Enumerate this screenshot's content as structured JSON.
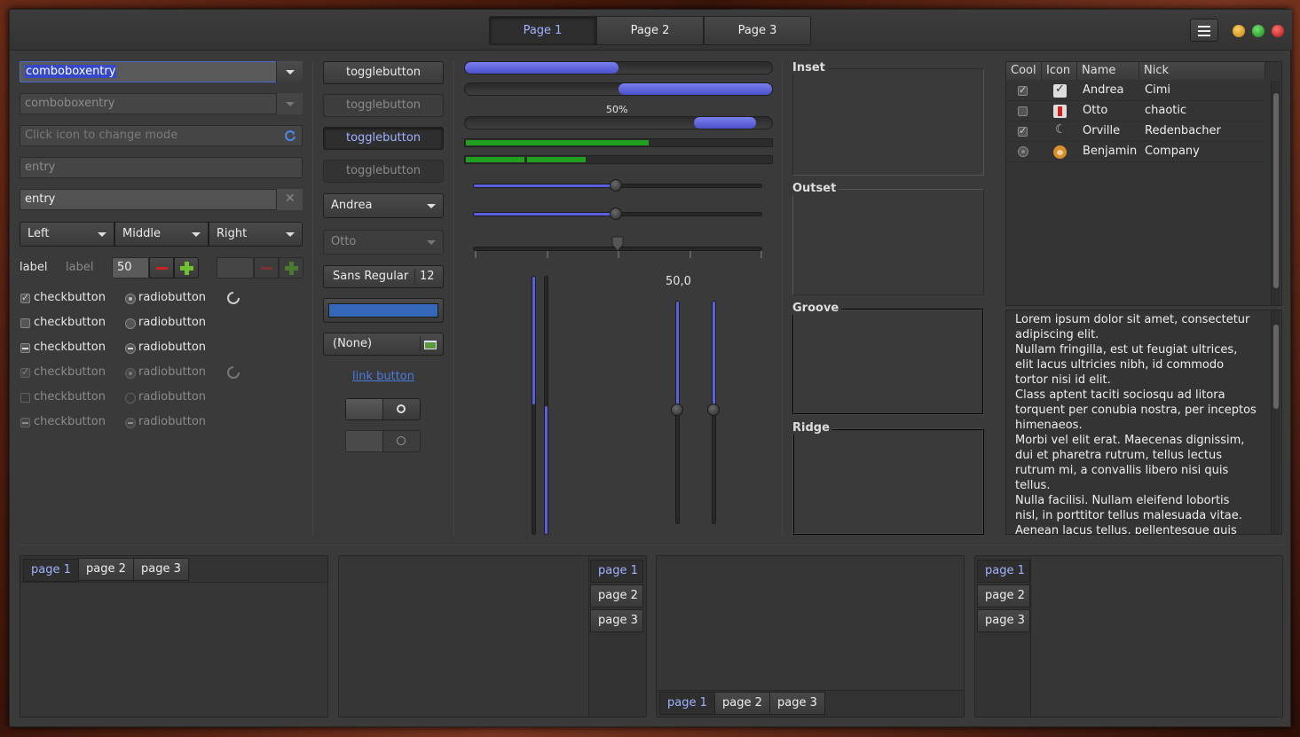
{
  "header": {
    "tabs": [
      "Page 1",
      "Page 2",
      "Page 3"
    ],
    "menu_icon": "hamburger-icon",
    "window_buttons": [
      "minimize-icon",
      "maximize-icon",
      "close-icon"
    ],
    "window_button_colors": [
      "#e0a020",
      "#30b030",
      "#e03030"
    ]
  },
  "col1": {
    "combo1": "comboboxentry",
    "combo2": "comboboxentry",
    "entry_icon_placeholder": "Click icon to change mode",
    "entry_dis": "entry",
    "entry": "entry",
    "combo_left": "Left",
    "combo_middle": "Middle",
    "combo_right": "Right",
    "label1": "label",
    "label2": "label",
    "spin_value": "50",
    "checks": [
      "checkbutton",
      "checkbutton",
      "checkbutton",
      "checkbutton",
      "checkbutton",
      "checkbutton"
    ],
    "radios": [
      "radiobutton",
      "radiobutton",
      "radiobutton",
      "radiobutton",
      "radiobutton",
      "radiobutton"
    ]
  },
  "col2": {
    "toggles": [
      "togglebutton",
      "togglebutton",
      "togglebutton",
      "togglebutton"
    ],
    "combo_andrea": "Andrea",
    "combo_otto": "Otto",
    "font_name": "Sans Regular",
    "font_size": "12",
    "color_value": "#3568b8",
    "file_chooser": "(None)",
    "link": "link button"
  },
  "col3": {
    "progress": [
      0.5,
      0.5,
      0.5
    ],
    "progress_label": "50%",
    "level": [
      0.6,
      0.4
    ],
    "scale_value_label": "50,0",
    "scales": [
      0.5,
      0.5,
      0.5
    ]
  },
  "frames": {
    "inset": "Inset",
    "outset": "Outset",
    "groove": "Groove",
    "ridge": "Ridge"
  },
  "tree": {
    "headers": [
      "Cool",
      "Icon",
      "Name",
      "Nick"
    ],
    "rows": [
      {
        "cool": "checked",
        "icon": "checkbox-icon",
        "name": "Andrea",
        "nick": "Cimi"
      },
      {
        "cool": "unchecked",
        "icon": "warning-icon",
        "name": "Otto",
        "nick": "chaotic"
      },
      {
        "cool": "checked",
        "icon": "moon-icon",
        "name": "Orville",
        "nick": "Redenbacher"
      },
      {
        "cool": "radio",
        "icon": "monkey-icon",
        "name": "Benjamin",
        "nick": "Company"
      }
    ]
  },
  "text": {
    "lines": [
      "Lorem ipsum dolor sit amet, consectetur",
      "adipiscing elit.",
      "Nullam fringilla, est ut feugiat ultrices,",
      "elit lacus ultricies nibh, id commodo",
      "tortor nisi id elit.",
      "Class aptent taciti sociosqu ad litora",
      "torquent per conubia nostra, per inceptos",
      "himenaeos.",
      "Morbi vel elit erat. Maecenas dignissim,",
      "dui et pharetra rutrum, tellus lectus",
      "rutrum mi, a convallis libero nisi quis",
      "tellus.",
      "Nulla facilisi. Nullam eleifend lobortis",
      "nisl, in porttitor tellus malesuada vitae.",
      "Aenean lacus tellus, pellentesque quis"
    ]
  },
  "notebooks": {
    "tabs": [
      "page 1",
      "page 2",
      "page 3"
    ]
  }
}
